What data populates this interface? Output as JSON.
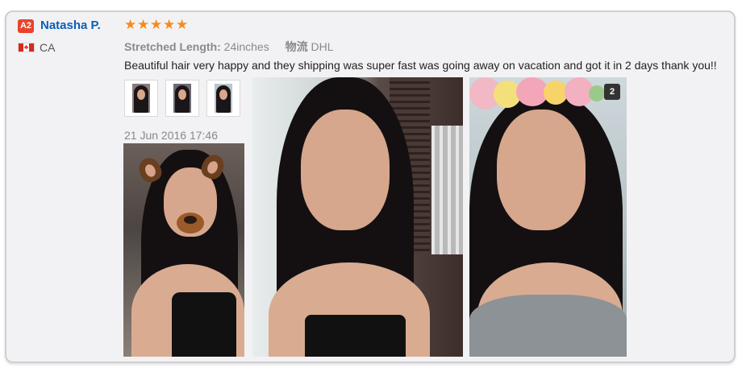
{
  "reviewer": {
    "badge": "A2",
    "name": "Natasha P.",
    "country": "CA",
    "flag_colors": {
      "red": "#d52b1e",
      "white": "#ffffff"
    }
  },
  "rating": {
    "stars": 5,
    "color": "#f68b1e"
  },
  "attributes": [
    {
      "key": "Stretched Length:",
      "value": "24inches"
    },
    {
      "key": "物流",
      "value": "DHL"
    }
  ],
  "review_text": "Beautiful hair very happy and they shipping was super fast was going away on vacation and got it in 2 days thank you!!",
  "thumbnails": [
    {
      "icon": "photo-thumbnail"
    },
    {
      "icon": "photo-thumbnail"
    },
    {
      "icon": "photo-thumbnail"
    }
  ],
  "date": "21 Jun 2016 17:46",
  "photos": [
    {
      "icon": "customer-photo-selfie-filter"
    },
    {
      "icon": "customer-photo-selfie"
    },
    {
      "icon": "customer-photo-flower-filter",
      "count_badge": "2"
    }
  ],
  "colors": {
    "link": "#0b5fb5",
    "badge": "#e9422b",
    "card_bg": "#f2f2f4",
    "muted": "#888888"
  }
}
